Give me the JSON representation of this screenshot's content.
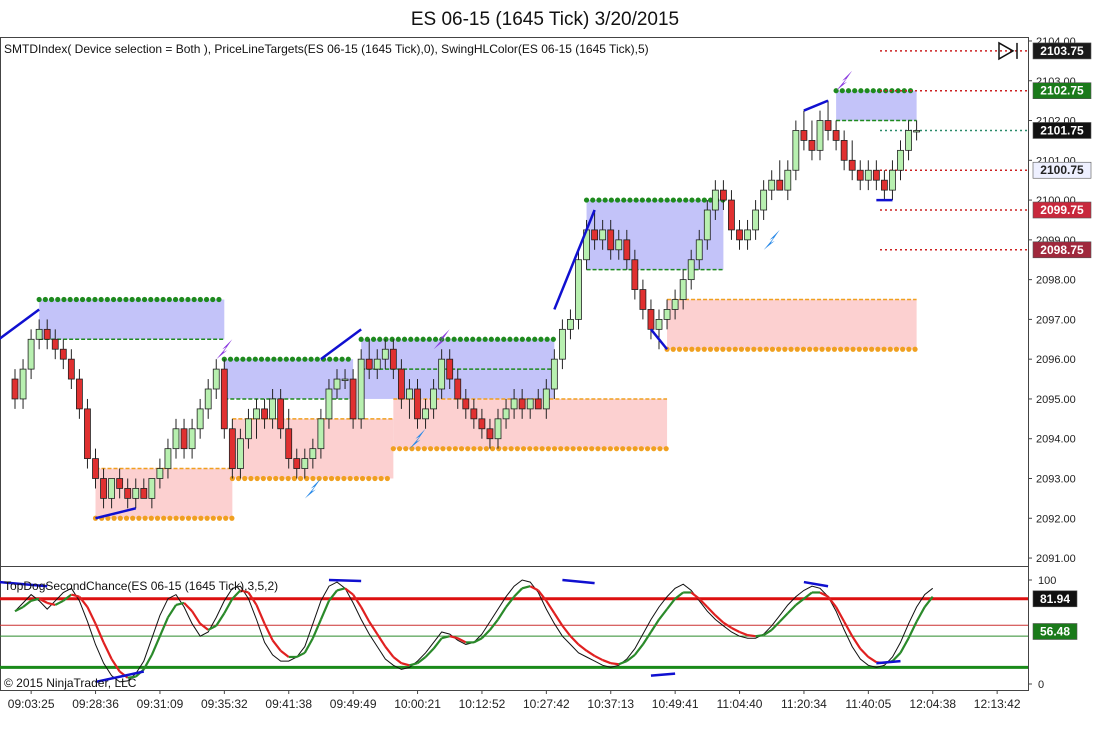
{
  "chart_title": "ES 06-15 (1645 Tick)  3/20/2015",
  "indicator_label": "SMTDIndex( Device selection = Both ), PriceLineTargets(ES 06-15 (1645 Tick),0), SwingHLColor(ES 06-15 (1645 Tick),5)",
  "oscillator_label": "TopDogSecondChance(ES 06-15 (1645 Tick),3,5,2)",
  "copyright": "© 2015 NinjaTrader, LLC",
  "colors": {
    "up_candle": "#b8f0b0",
    "down_candle": "#e03030",
    "green_dots": "#1e8a1e",
    "orange_dots": "#f0a020",
    "blue_zone": "#b8b8f8",
    "red_zone": "#fcc8c8",
    "fast_line": "#e02020",
    "slow_line": "#2a8a2a",
    "swing_line": "#1010d0"
  },
  "chart_data": [
    {
      "type": "candlestick",
      "title": "ES 06-15 (1645 Tick)  3/20/2015",
      "ylim": [
        2090.8,
        2104.1
      ],
      "y_ticks": [
        "2104.00",
        "2103.00",
        "2102.00",
        "2101.00",
        "2100.00",
        "2099.00",
        "2098.00",
        "2097.00",
        "2096.00",
        "2095.00",
        "2094.00",
        "2093.00",
        "2092.00",
        "2091.00"
      ],
      "x_ticks": [
        "09:03:25",
        "09:28:36",
        "09:31:09",
        "09:35:32",
        "09:41:38",
        "09:49:49",
        "10:00:21",
        "10:12:52",
        "10:27:42",
        "10:37:13",
        "10:49:41",
        "11:04:40",
        "11:20:34",
        "11:40:05",
        "12:04:38",
        "12:13:42"
      ],
      "x_tick_positions": [
        3,
        11,
        19,
        27,
        35,
        43,
        51,
        59,
        67,
        75,
        83,
        91,
        99,
        107,
        115,
        123
      ],
      "ohlc": [
        [
          2095.5,
          2095.75,
          2094.75,
          2095.0
        ],
        [
          2095.0,
          2096.0,
          2094.75,
          2095.75
        ],
        [
          2095.75,
          2096.75,
          2095.5,
          2096.5
        ],
        [
          2096.5,
          2097.0,
          2096.25,
          2096.75
        ],
        [
          2096.75,
          2097.0,
          2096.25,
          2096.5
        ],
        [
          2096.5,
          2096.75,
          2096.0,
          2096.25
        ],
        [
          2096.25,
          2096.5,
          2095.75,
          2096.0
        ],
        [
          2096.0,
          2096.25,
          2095.25,
          2095.5
        ],
        [
          2095.5,
          2095.75,
          2094.5,
          2094.75
        ],
        [
          2094.75,
          2095.0,
          2093.25,
          2093.5
        ],
        [
          2093.5,
          2093.75,
          2092.75,
          2093.0
        ],
        [
          2093.0,
          2093.25,
          2092.25,
          2092.5
        ],
        [
          2092.5,
          2093.0,
          2092.25,
          2093.0
        ],
        [
          2093.0,
          2093.25,
          2092.5,
          2092.75
        ],
        [
          2092.75,
          2093.0,
          2092.25,
          2092.5
        ],
        [
          2092.5,
          2093.0,
          2092.25,
          2092.75
        ],
        [
          2092.75,
          2093.0,
          2092.5,
          2092.5
        ],
        [
          2092.5,
          2093.0,
          2092.25,
          2093.0
        ],
        [
          2093.0,
          2093.5,
          2092.75,
          2093.25
        ],
        [
          2093.25,
          2094.0,
          2093.0,
          2093.75
        ],
        [
          2093.75,
          2094.5,
          2093.5,
          2094.25
        ],
        [
          2094.25,
          2094.5,
          2093.5,
          2093.75
        ],
        [
          2093.75,
          2094.5,
          2093.5,
          2094.25
        ],
        [
          2094.25,
          2095.0,
          2094.0,
          2094.75
        ],
        [
          2094.75,
          2095.5,
          2094.5,
          2095.25
        ],
        [
          2095.25,
          2096.0,
          2095.0,
          2095.75
        ],
        [
          2095.75,
          2096.0,
          2094.0,
          2094.25
        ],
        [
          2094.25,
          2094.5,
          2093.0,
          2093.25
        ],
        [
          2093.25,
          2094.25,
          2093.0,
          2094.0
        ],
        [
          2094.0,
          2094.75,
          2093.75,
          2094.5
        ],
        [
          2094.5,
          2095.0,
          2094.0,
          2094.75
        ],
        [
          2094.75,
          2095.0,
          2094.25,
          2094.5
        ],
        [
          2094.5,
          2095.25,
          2094.25,
          2095.0
        ],
        [
          2095.0,
          2095.25,
          2094.0,
          2094.25
        ],
        [
          2094.25,
          2094.75,
          2093.25,
          2093.5
        ],
        [
          2093.5,
          2093.75,
          2093.0,
          2093.25
        ],
        [
          2093.25,
          2093.75,
          2093.0,
          2093.5
        ],
        [
          2093.5,
          2094.0,
          2093.25,
          2093.75
        ],
        [
          2093.75,
          2094.75,
          2093.5,
          2094.5
        ],
        [
          2094.5,
          2095.5,
          2094.25,
          2095.25
        ],
        [
          2095.25,
          2095.75,
          2095.0,
          2095.5
        ],
        [
          2095.5,
          2095.75,
          2095.25,
          2095.5
        ],
        [
          2095.5,
          2095.75,
          2094.25,
          2094.5
        ],
        [
          2094.5,
          2096.25,
          2094.25,
          2096.0
        ],
        [
          2096.0,
          2096.5,
          2095.5,
          2095.75
        ],
        [
          2095.75,
          2096.25,
          2095.5,
          2096.0
        ],
        [
          2096.0,
          2096.5,
          2095.75,
          2096.25
        ],
        [
          2096.25,
          2096.5,
          2095.5,
          2095.75
        ],
        [
          2095.75,
          2096.0,
          2094.75,
          2095.0
        ],
        [
          2095.0,
          2095.5,
          2094.5,
          2095.25
        ],
        [
          2095.25,
          2095.5,
          2094.25,
          2094.5
        ],
        [
          2094.5,
          2095.0,
          2094.25,
          2094.75
        ],
        [
          2094.75,
          2095.5,
          2094.5,
          2095.25
        ],
        [
          2095.25,
          2096.25,
          2095.0,
          2096.0
        ],
        [
          2096.0,
          2096.25,
          2095.25,
          2095.5
        ],
        [
          2095.5,
          2095.75,
          2094.75,
          2095.0
        ],
        [
          2095.0,
          2095.25,
          2094.5,
          2094.75
        ],
        [
          2094.75,
          2095.0,
          2094.25,
          2094.5
        ],
        [
          2094.5,
          2094.75,
          2094.0,
          2094.25
        ],
        [
          2094.25,
          2094.5,
          2093.75,
          2094.0
        ],
        [
          2094.0,
          2094.75,
          2093.75,
          2094.5
        ],
        [
          2094.5,
          2095.0,
          2094.25,
          2094.75
        ],
        [
          2094.75,
          2095.25,
          2094.5,
          2095.0
        ],
        [
          2095.0,
          2095.25,
          2094.5,
          2094.75
        ],
        [
          2094.75,
          2095.0,
          2094.5,
          2095.0
        ],
        [
          2095.0,
          2095.25,
          2094.75,
          2094.75
        ],
        [
          2094.75,
          2095.5,
          2094.5,
          2095.25
        ],
        [
          2095.25,
          2096.25,
          2095.0,
          2096.0
        ],
        [
          2096.0,
          2097.0,
          2095.75,
          2096.75
        ],
        [
          2096.75,
          2097.25,
          2096.5,
          2097.0
        ],
        [
          2097.0,
          2098.75,
          2096.75,
          2098.5
        ],
        [
          2098.5,
          2099.5,
          2098.25,
          2099.25
        ],
        [
          2099.25,
          2099.75,
          2098.75,
          2099.0
        ],
        [
          2099.0,
          2099.5,
          2098.75,
          2099.25
        ],
        [
          2099.25,
          2099.5,
          2098.5,
          2098.75
        ],
        [
          2098.75,
          2099.25,
          2098.5,
          2099.0
        ],
        [
          2099.0,
          2099.25,
          2098.25,
          2098.5
        ],
        [
          2098.5,
          2098.75,
          2097.5,
          2097.75
        ],
        [
          2097.75,
          2098.0,
          2097.0,
          2097.25
        ],
        [
          2097.25,
          2097.5,
          2096.5,
          2096.75
        ],
        [
          2096.75,
          2097.25,
          2096.25,
          2097.0
        ],
        [
          2097.0,
          2097.5,
          2096.75,
          2097.25
        ],
        [
          2097.25,
          2097.75,
          2097.0,
          2097.5
        ],
        [
          2097.5,
          2098.25,
          2097.25,
          2098.0
        ],
        [
          2098.0,
          2098.75,
          2097.75,
          2098.5
        ],
        [
          2098.5,
          2099.25,
          2098.25,
          2099.0
        ],
        [
          2099.0,
          2100.0,
          2098.75,
          2099.75
        ],
        [
          2099.75,
          2100.5,
          2099.5,
          2100.25
        ],
        [
          2100.25,
          2100.5,
          2099.75,
          2100.0
        ],
        [
          2100.0,
          2100.25,
          2099.0,
          2099.25
        ],
        [
          2099.25,
          2099.5,
          2098.75,
          2099.0
        ],
        [
          2099.0,
          2099.5,
          2098.75,
          2099.25
        ],
        [
          2099.25,
          2100.0,
          2099.0,
          2099.75
        ],
        [
          2099.75,
          2100.5,
          2099.5,
          2100.25
        ],
        [
          2100.25,
          2100.75,
          2100.0,
          2100.5
        ],
        [
          2100.5,
          2101.0,
          2100.25,
          2100.25
        ],
        [
          2100.25,
          2101.0,
          2100.0,
          2100.75
        ],
        [
          2100.75,
          2102.0,
          2100.5,
          2101.75
        ],
        [
          2101.75,
          2102.25,
          2101.25,
          2101.5
        ],
        [
          2101.5,
          2102.0,
          2101.0,
          2101.25
        ],
        [
          2101.25,
          2102.25,
          2101.0,
          2102.0
        ],
        [
          2102.0,
          2102.5,
          2101.5,
          2101.75
        ],
        [
          2101.75,
          2102.0,
          2101.25,
          2101.5
        ],
        [
          2101.5,
          2101.75,
          2100.75,
          2101.0
        ],
        [
          2101.0,
          2101.5,
          2100.5,
          2100.75
        ],
        [
          2100.75,
          2101.0,
          2100.25,
          2100.5
        ],
        [
          2100.5,
          2101.0,
          2100.25,
          2100.75
        ],
        [
          2100.75,
          2101.0,
          2100.25,
          2100.5
        ],
        [
          2100.5,
          2100.75,
          2100.0,
          2100.25
        ],
        [
          2100.25,
          2101.0,
          2100.0,
          2100.75
        ],
        [
          2100.75,
          2101.5,
          2100.5,
          2101.25
        ],
        [
          2101.25,
          2102.0,
          2101.0,
          2101.75
        ],
        [
          2101.75,
          2102.0,
          2101.5,
          2101.75
        ]
      ],
      "price_tags": [
        {
          "label": "2103.75",
          "value": 2103.75,
          "bg": "#1a1a1a",
          "fg": "#ffffff"
        },
        {
          "label": "2102.75",
          "value": 2102.75,
          "bg": "#1a7a1a",
          "fg": "#ffffff"
        },
        {
          "label": "2101.75",
          "value": 2101.75,
          "bg": "#111111",
          "fg": "#ffffff"
        },
        {
          "label": "2100.75",
          "value": 2100.75,
          "bg": "#eef0ff",
          "fg": "#222222"
        },
        {
          "label": "2099.75",
          "value": 2099.75,
          "bg": "#c8283c",
          "fg": "#ffffff"
        },
        {
          "label": "2098.75",
          "value": 2098.75,
          "bg": "#a0283c",
          "fg": "#ffffff"
        }
      ]
    },
    {
      "type": "line",
      "title": "TopDogSecondChance(ES 06-15 (1645 Tick),3,5,2)",
      "ylim": [
        0,
        100
      ],
      "y_ticks": [
        "100",
        "0"
      ],
      "reference_levels": [
        {
          "value": 81.94,
          "label": "81.94",
          "color": "#dd1010"
        },
        {
          "value": 56.48,
          "label": "56.48",
          "color": "#1a8a1a"
        }
      ],
      "series": [
        {
          "values": [
            70,
            78,
            86,
            80,
            72,
            80,
            88,
            92,
            80,
            60,
            38,
            20,
            8,
            2,
            3,
            10,
            22,
            44,
            66,
            82,
            86,
            74,
            58,
            46,
            50,
            64,
            80,
            92,
            94,
            82,
            62,
            40,
            28,
            22,
            22,
            26,
            36,
            58,
            80,
            94,
            98,
            92,
            78,
            62,
            48,
            36,
            24,
            18,
            14,
            16,
            22,
            30,
            40,
            50,
            48,
            42,
            38,
            40,
            48,
            60,
            72,
            84,
            94,
            100,
            98,
            88,
            72,
            58,
            46,
            38,
            30,
            26,
            22,
            18,
            16,
            18,
            24,
            34,
            48,
            62,
            74,
            84,
            92,
            96,
            90,
            80,
            70,
            62,
            56,
            50,
            46,
            44,
            44,
            48,
            56,
            66,
            76,
            84,
            90,
            94,
            92,
            84,
            70,
            52,
            36,
            24,
            18,
            16,
            18,
            26,
            40,
            58,
            74,
            86,
            92
          ]
        },
        {
          "values": [
            70,
            74,
            80,
            82,
            78,
            76,
            80,
            86,
            84,
            74,
            58,
            40,
            24,
            12,
            6,
            7,
            14,
            28,
            46,
            64,
            76,
            78,
            70,
            58,
            52,
            56,
            68,
            82,
            90,
            88,
            76,
            58,
            42,
            32,
            26,
            26,
            30,
            44,
            62,
            80,
            90,
            92,
            86,
            74,
            60,
            48,
            36,
            26,
            20,
            18,
            20,
            26,
            34,
            44,
            46,
            44,
            40,
            40,
            44,
            52,
            62,
            74,
            84,
            92,
            94,
            90,
            80,
            68,
            56,
            46,
            38,
            32,
            27,
            23,
            20,
            19,
            22,
            28,
            38,
            50,
            62,
            72,
            82,
            88,
            88,
            82,
            74,
            66,
            59,
            54,
            50,
            47,
            46,
            47,
            52,
            60,
            68,
            76,
            82,
            88,
            88,
            84,
            74,
            60,
            46,
            34,
            26,
            21,
            20,
            22,
            30,
            44,
            60,
            74,
            84
          ]
        }
      ],
      "x_ticks": [
        "09:03:25",
        "09:28:36",
        "09:31:09",
        "09:35:32",
        "09:41:38",
        "09:49:49",
        "10:00:21",
        "10:12:52",
        "10:27:42",
        "10:37:13",
        "10:49:41",
        "11:04:40",
        "11:20:34",
        "11:40:05",
        "12:04:38",
        "12:13:42"
      ]
    }
  ]
}
